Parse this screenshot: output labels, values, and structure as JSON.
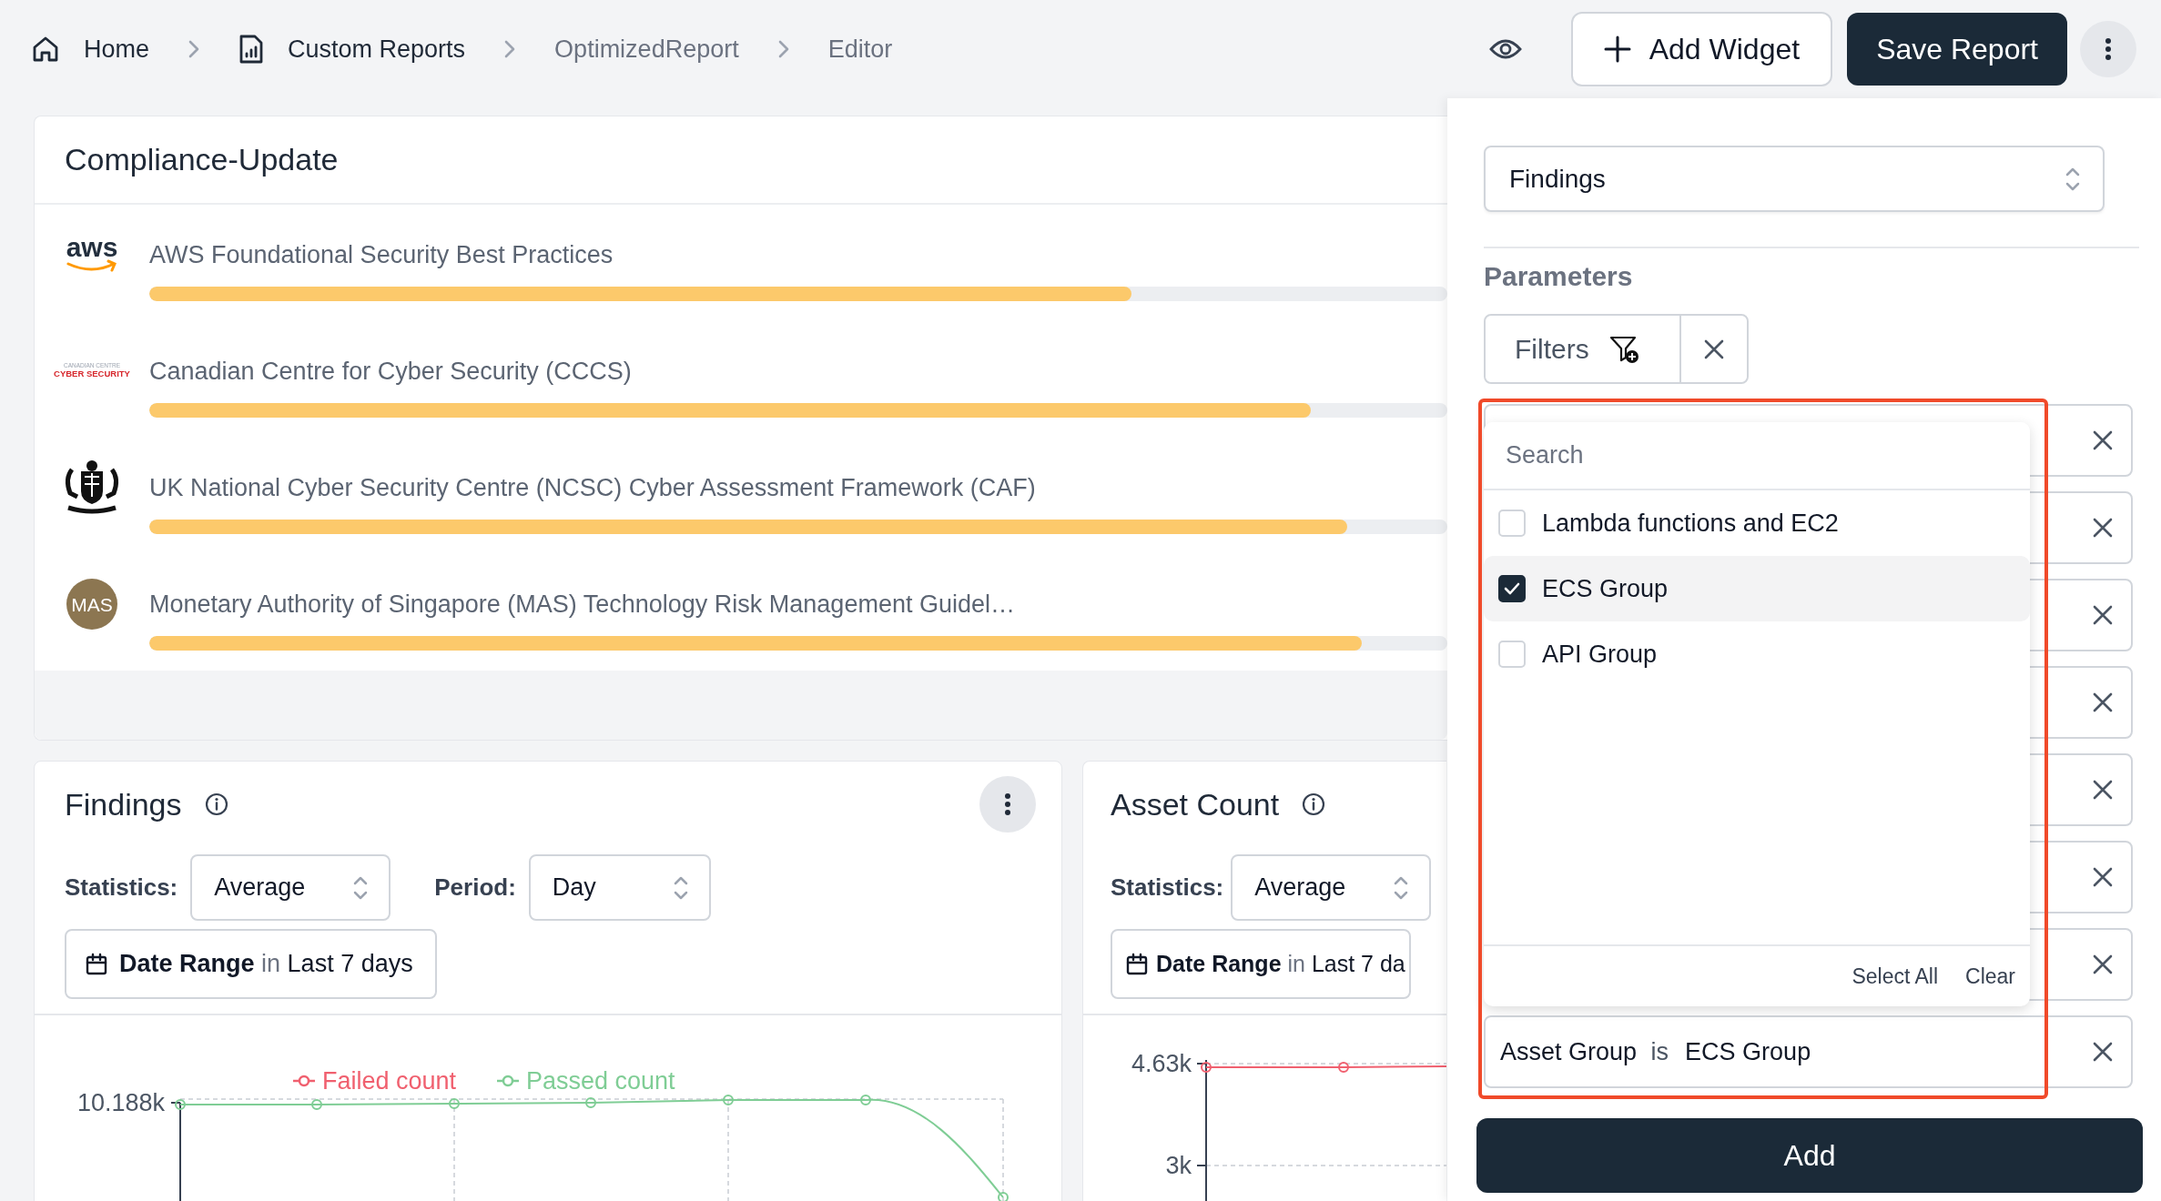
{
  "breadcrumbs": [
    {
      "kind": "home",
      "label": "Home"
    },
    {
      "kind": "report",
      "label": "Custom Reports"
    },
    {
      "kind": "plain",
      "label": "OptimizedReport"
    },
    {
      "kind": "plain",
      "label": "Editor"
    }
  ],
  "actions": {
    "add_widget": "Add Widget",
    "save": "Save Report"
  },
  "compliance": {
    "title": "Compliance-Update",
    "items": [
      {
        "logo": {
          "kind": "aws",
          "lines": [
            "aws"
          ]
        },
        "name": "AWS Foundational Security Best Practices",
        "level": 0.757
      },
      {
        "logo": {
          "kind": "cccs",
          "lines": [
            "CANADIAN CENTRE",
            "CYBER SECURITY"
          ]
        },
        "name": "Canadian Centre for Cyber Security (CCCS)",
        "level": 0.895
      },
      {
        "logo": {
          "kind": "crest"
        },
        "name": "UK National Cyber Security Centre (NCSC) Cyber Assessment Framework (CAF)",
        "level": 0.923
      },
      {
        "logo": {
          "kind": "mas",
          "lines": [
            "MAS"
          ]
        },
        "name": "Monetary Authority of Singapore (MAS) Technology Risk Management Guidel…",
        "level": 0.934
      }
    ]
  },
  "widgets": [
    {
      "kind": "findings",
      "title": "Findings",
      "statistics_label": "Statistics:",
      "statistics": "Average",
      "period_label": "Period:",
      "period": "Day",
      "date_label": "Date Range",
      "date_op": "in",
      "date_value": "Last 7 days",
      "chart": {
        "legend": [
          {
            "label": "Failed count",
            "color": "#f0606f"
          },
          {
            "label": "Passed count",
            "color": "#7fcd95"
          }
        ],
        "y_tick_labels": [
          "10.188k"
        ]
      }
    },
    {
      "kind": "asset",
      "title": "Asset Count",
      "statistics_label": "Statistics:",
      "statistics": "Average",
      "date_label": "Date Range",
      "date_op": "in",
      "date_value": "Last 7 da",
      "chart": {
        "y_tick_labels": [
          "4.63k",
          "3k"
        ]
      }
    }
  ],
  "panel": {
    "source": "Findings",
    "parameters_label": "Parameters",
    "filters_button": "Filters",
    "filter_rows": [
      {
        "kind": "covered"
      },
      {
        "kind": "covered"
      },
      {
        "kind": "covered"
      },
      {
        "kind": "covered"
      },
      {
        "kind": "covered"
      },
      {
        "kind": "covered"
      },
      {
        "kind": "covered"
      },
      {
        "kind": "condition",
        "field": "Asset Group",
        "operator": "is",
        "value": "ECS Group"
      }
    ],
    "dropdown": {
      "placeholder": "Search",
      "options": [
        {
          "label": "Lambda functions and EC2",
          "checked": false,
          "selected": false
        },
        {
          "label": "ECS Group",
          "checked": true,
          "selected": true
        },
        {
          "label": "API Group",
          "checked": false,
          "selected": false
        }
      ],
      "select_all": "Select All",
      "clear": "Clear"
    },
    "add_button": "Add"
  }
}
